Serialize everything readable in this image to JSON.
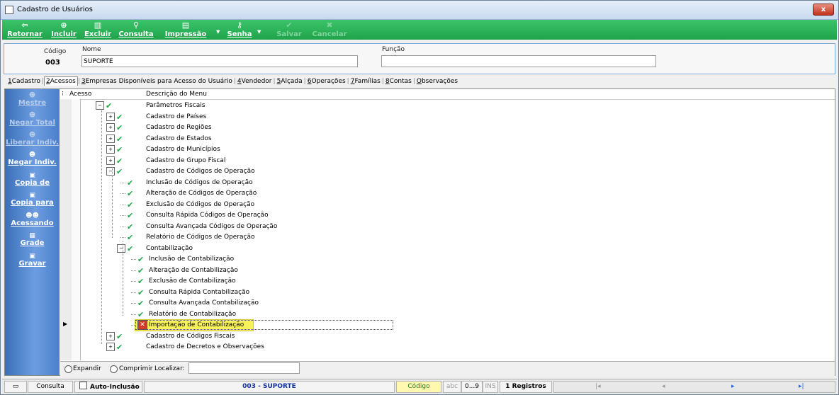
{
  "window": {
    "title": "Cadastro de Usuários",
    "close_label": "x"
  },
  "toolbar": {
    "retornar": "Retornar",
    "incluir": "Incluir",
    "excluir": "Excluir",
    "consulta": "Consulta",
    "impressao": "Impressão",
    "senha": "Senha",
    "salvar": "Salvar",
    "cancelar": "Cancelar"
  },
  "header": {
    "codigo_label": "Código",
    "codigo_value": "003",
    "nome_label": "Nome",
    "nome_value": "SUPORTE",
    "funcao_label": "Função",
    "funcao_value": ""
  },
  "tabs": [
    {
      "num": "1",
      "label": " Cadastro"
    },
    {
      "num": "2",
      "label": " Acessos"
    },
    {
      "num": "3",
      "label": " Empresas Disponíveis para Acesso do Usuário"
    },
    {
      "num": "4",
      "label": " Vendedor"
    },
    {
      "num": "5",
      "label": " Alçada"
    },
    {
      "num": "6",
      "label": " Operações"
    },
    {
      "num": "7",
      "label": " Famílias"
    },
    {
      "num": "8",
      "label": " Contas"
    },
    {
      "num": "O",
      "label": "bservações"
    }
  ],
  "sidebar": [
    {
      "label": "Mestre",
      "icon": "user-icon",
      "dim": true
    },
    {
      "label": "Negar Total",
      "icon": "user-deny-icon",
      "dim": true
    },
    {
      "label": "Liberar Indiv.",
      "icon": "user-allow-icon",
      "dim": true
    },
    {
      "label": "Negar Indiv.",
      "icon": "user-remove-icon",
      "dim": false
    },
    {
      "label": "Copia de",
      "icon": "copy-icon",
      "dim": false
    },
    {
      "label": "Copia para",
      "icon": "copy-to-icon",
      "dim": false
    },
    {
      "label": "Acessando",
      "icon": "users-icon",
      "dim": false
    },
    {
      "label": "Grade",
      "icon": "grid-icon",
      "dim": false
    },
    {
      "label": "Gravar",
      "icon": "save-icon",
      "dim": false
    }
  ],
  "grid": {
    "col_acesso": "Acesso",
    "col_desc": "Descrição do Menu",
    "rows": [
      {
        "text": "Parâmetros Fiscais",
        "level": 0,
        "expander": "-",
        "access": "check"
      },
      {
        "text": "Cadastro de Países",
        "level": 1,
        "expander": "+",
        "access": "check"
      },
      {
        "text": "Cadastro de Regiões",
        "level": 1,
        "expander": "+",
        "access": "check"
      },
      {
        "text": "Cadastro de Estados",
        "level": 1,
        "expander": "+",
        "access": "check"
      },
      {
        "text": "Cadastro de Municípios",
        "level": 1,
        "expander": "+",
        "access": "check"
      },
      {
        "text": "Cadastro de Grupo Fiscal",
        "level": 1,
        "expander": "+",
        "access": "check"
      },
      {
        "text": "Cadastro de Códigos de Operação",
        "level": 1,
        "expander": "-",
        "access": "check"
      },
      {
        "text": "Inclusão de Códigos de Operação",
        "level": 2,
        "expander": "",
        "access": "check"
      },
      {
        "text": "Alteração de Códigos de Operação",
        "level": 2,
        "expander": "",
        "access": "check"
      },
      {
        "text": "Exclusão de Códigos de Operação",
        "level": 2,
        "expander": "",
        "access": "check"
      },
      {
        "text": "Consulta Rápida Códigos de Operação",
        "level": 2,
        "expander": "",
        "access": "check"
      },
      {
        "text": "Consulta Avançada Códigos de Operação",
        "level": 2,
        "expander": "",
        "access": "check"
      },
      {
        "text": "Relatório de Códigos de Operação",
        "level": 2,
        "expander": "",
        "access": "check"
      },
      {
        "text": "Contabilização",
        "level": 2,
        "expander": "-",
        "access": "check"
      },
      {
        "text": "Inclusão de Contabilização",
        "level": 3,
        "expander": "",
        "access": "check"
      },
      {
        "text": "Alteração de Contabilização",
        "level": 3,
        "expander": "",
        "access": "check"
      },
      {
        "text": "Exclusão de Contabilização",
        "level": 3,
        "expander": "",
        "access": "check"
      },
      {
        "text": "Consulta Rápida Contabilização",
        "level": 3,
        "expander": "",
        "access": "check"
      },
      {
        "text": "Consulta Avançada Contabilização",
        "level": 3,
        "expander": "",
        "access": "check"
      },
      {
        "text": "Relatório de Contabilização",
        "level": 3,
        "expander": "",
        "access": "check"
      },
      {
        "text": "Importação de Contabilização",
        "level": 3,
        "expander": "",
        "access": "denied",
        "selected": true
      },
      {
        "text": "Cadastro de Códigos Fiscais",
        "level": 1,
        "expander": "+",
        "access": "check"
      },
      {
        "text": "Cadastro de Decretos e Observações",
        "level": 1,
        "expander": "+",
        "access": "check"
      }
    ]
  },
  "footer": {
    "expandir": "Expandir",
    "comprimir": "Comprimir",
    "localizar": "Localizar:"
  },
  "status": {
    "mode": "Consulta",
    "auto": "Auto-Inclusão",
    "record": "003 - SUPORTE",
    "field": "Código",
    "abc": "abc",
    "num": "0...9",
    "ins": "INS",
    "count": "1 Registros"
  },
  "colors": {
    "toolbar": "#1fa34a",
    "check": "#1fa84a",
    "highlight": "#f7f15a",
    "sidebar": "#4a7fcb"
  }
}
